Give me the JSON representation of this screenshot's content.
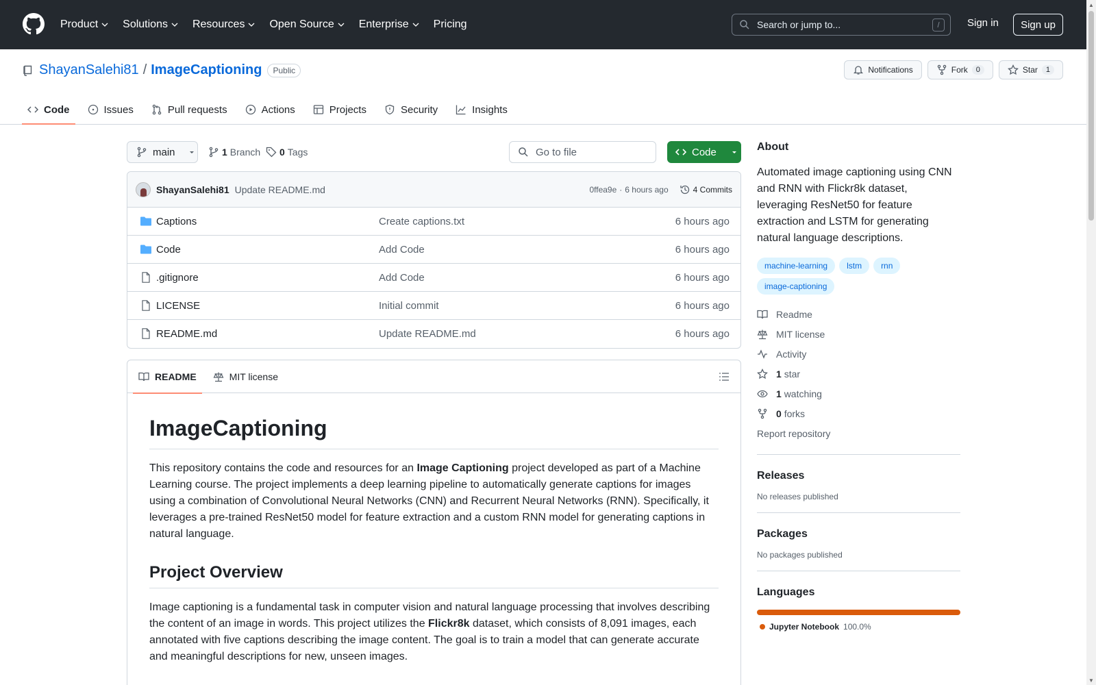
{
  "header": {
    "nav": [
      "Product",
      "Solutions",
      "Resources",
      "Open Source",
      "Enterprise",
      "Pricing"
    ],
    "search_placeholder": "Search or jump to...",
    "search_shortcut": "/",
    "signin": "Sign in",
    "signup": "Sign up"
  },
  "repo": {
    "owner": "ShayanSalehi81",
    "separator": "/",
    "name": "ImageCaptioning",
    "visibility": "Public",
    "notifications_label": "Notifications",
    "fork_label": "Fork",
    "fork_count": "0",
    "star_label": "Star",
    "star_count": "1"
  },
  "tabs": [
    {
      "label": "Code",
      "icon": "code-icon"
    },
    {
      "label": "Issues",
      "icon": "issue-icon"
    },
    {
      "label": "Pull requests",
      "icon": "pull-request-icon"
    },
    {
      "label": "Actions",
      "icon": "play-icon"
    },
    {
      "label": "Projects",
      "icon": "table-icon"
    },
    {
      "label": "Security",
      "icon": "shield-icon"
    },
    {
      "label": "Insights",
      "icon": "graph-icon"
    }
  ],
  "toolbar": {
    "branch": "main",
    "branch_count": "1",
    "branch_label": "Branch",
    "tag_count": "0",
    "tag_label": "Tags",
    "goto_placeholder": "Go to file",
    "code_button": "Code"
  },
  "latest_commit": {
    "author": "ShayanSalehi81",
    "message": "Update README.md",
    "hash": "0ffea9e",
    "dot": "·",
    "age": "6 hours ago",
    "commits": "4 Commits"
  },
  "files": [
    {
      "name": "Captions",
      "type": "dir",
      "commit": "Create captions.txt",
      "age": "6 hours ago"
    },
    {
      "name": "Code",
      "type": "dir",
      "commit": "Add Code",
      "age": "6 hours ago"
    },
    {
      "name": ".gitignore",
      "type": "file",
      "commit": "Add Code",
      "age": "6 hours ago"
    },
    {
      "name": "LICENSE",
      "type": "file",
      "commit": "Initial commit",
      "age": "6 hours ago"
    },
    {
      "name": "README.md",
      "type": "file",
      "commit": "Update README.md",
      "age": "6 hours ago"
    }
  ],
  "readme": {
    "tab_readme": "README",
    "tab_license": "MIT license",
    "title": "ImageCaptioning",
    "p1_a": "This repository contains the code and resources for an ",
    "p1_b": "Image Captioning",
    "p1_c": " project developed as part of a Machine Learning course. The project implements a deep learning pipeline to automatically generate captions for images using a combination of Convolutional Neural Networks (CNN) and Recurrent Neural Networks (RNN). Specifically, it leverages a pre-trained ResNet50 model for feature extraction and a custom RNN model for generating captions in natural language.",
    "h2": "Project Overview",
    "p2_a": "Image captioning is a fundamental task in computer vision and natural language processing that involves describing the content of an image in words. This project utilizes the ",
    "p2_b": "Flickr8k",
    "p2_c": " dataset, which consists of 8,091 images, each annotated with five captions describing the image content. The goal is to train a model that can generate accurate and meaningful descriptions for new, unseen images."
  },
  "about": {
    "title": "About",
    "description": "Automated image captioning using CNN and RNN with Flickr8k dataset, leveraging ResNet50 for feature extraction and LSTM for generating natural language descriptions.",
    "topics": [
      "machine-learning",
      "lstm",
      "rnn",
      "image-captioning"
    ],
    "readme": "Readme",
    "license": "MIT license",
    "activity": "Activity",
    "stars_count": "1",
    "stars_label": "star",
    "watching_count": "1",
    "watching_label": "watching",
    "forks_count": "0",
    "forks_label": "forks",
    "report": "Report repository"
  },
  "releases": {
    "title": "Releases",
    "text": "No releases published"
  },
  "packages": {
    "title": "Packages",
    "text": "No packages published"
  },
  "languages": {
    "title": "Languages",
    "name": "Jupyter Notebook",
    "percent": "100.0%",
    "fraction": 1.0,
    "color": "#DA5B0B"
  },
  "colors": {
    "header_bg": "#24292f",
    "link": "#0969da",
    "green": "#1f883d",
    "tab_underline": "#fd8c73"
  }
}
